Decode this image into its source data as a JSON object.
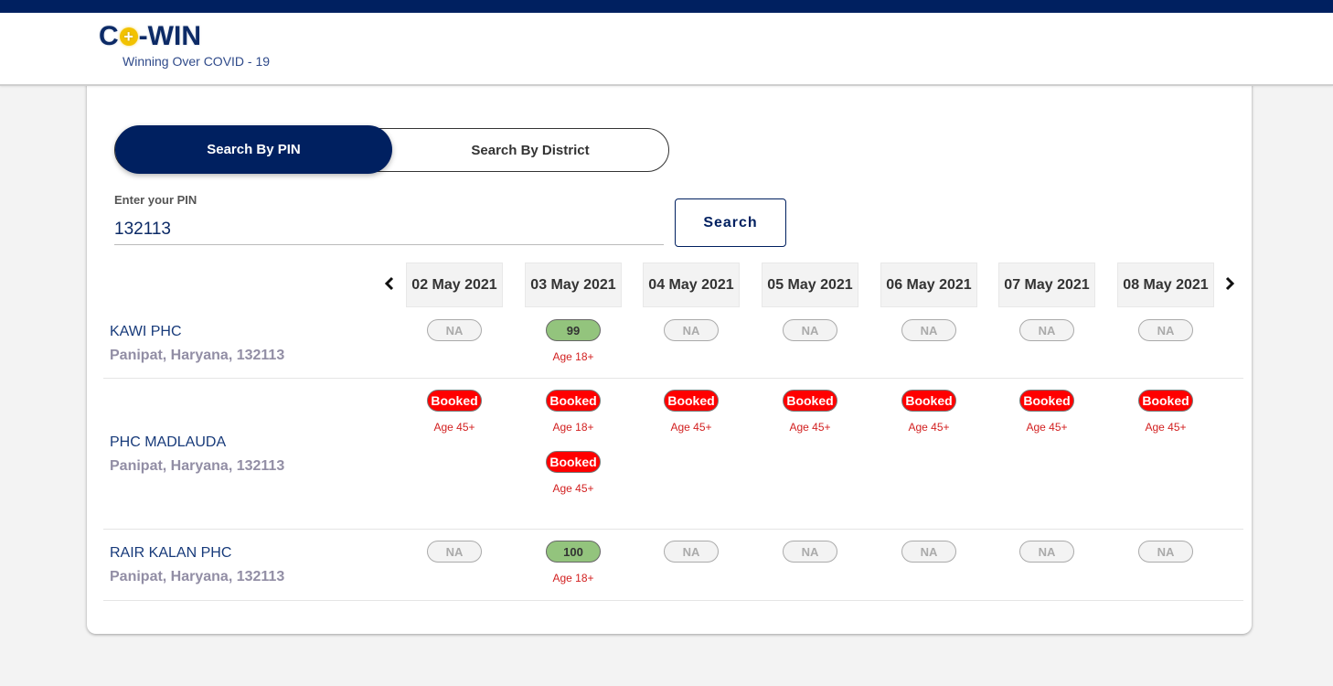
{
  "header": {
    "logo_text_left": "C",
    "logo_text_right": "-WIN",
    "logo_plus_symbol": "+",
    "tagline": "Winning Over COVID - 19"
  },
  "search": {
    "tabs": [
      {
        "label": "Search By PIN",
        "active": true
      },
      {
        "label": "Search By District",
        "active": false
      }
    ],
    "pin_label": "Enter your PIN",
    "pin_value": "132113",
    "search_button": "Search"
  },
  "dates": {
    "prev_icon": "‹",
    "next_icon": "›",
    "list": [
      "02 May 2021",
      "03 May 2021",
      "04 May 2021",
      "05 May 2021",
      "06 May 2021",
      "07 May 2021",
      "08 May 2021"
    ]
  },
  "centers": [
    {
      "name": "KAWI PHC",
      "address": "Panipat, Haryana, 132113",
      "slots": [
        [
          {
            "status": "NA",
            "label": "NA"
          }
        ],
        [
          {
            "status": "available",
            "label": "99",
            "age": "Age 18+"
          }
        ],
        [
          {
            "status": "NA",
            "label": "NA"
          }
        ],
        [
          {
            "status": "NA",
            "label": "NA"
          }
        ],
        [
          {
            "status": "NA",
            "label": "NA"
          }
        ],
        [
          {
            "status": "NA",
            "label": "NA"
          }
        ],
        [
          {
            "status": "NA",
            "label": "NA"
          }
        ]
      ]
    },
    {
      "name": "PHC MADLAUDA",
      "address": "Panipat, Haryana, 132113",
      "slots": [
        [
          {
            "status": "booked",
            "label": "Booked",
            "age": "Age 45+"
          }
        ],
        [
          {
            "status": "booked",
            "label": "Booked",
            "age": "Age 18+"
          },
          {
            "status": "booked",
            "label": "Booked",
            "age": "Age 45+"
          }
        ],
        [
          {
            "status": "booked",
            "label": "Booked",
            "age": "Age 45+"
          }
        ],
        [
          {
            "status": "booked",
            "label": "Booked",
            "age": "Age 45+"
          }
        ],
        [
          {
            "status": "booked",
            "label": "Booked",
            "age": "Age 45+"
          }
        ],
        [
          {
            "status": "booked",
            "label": "Booked",
            "age": "Age 45+"
          }
        ],
        [
          {
            "status": "booked",
            "label": "Booked",
            "age": "Age 45+"
          }
        ]
      ]
    },
    {
      "name": "RAIR KALAN PHC",
      "address": "Panipat, Haryana, 132113",
      "slots": [
        [
          {
            "status": "NA",
            "label": "NA"
          }
        ],
        [
          {
            "status": "available",
            "label": "100",
            "age": "Age 18+"
          }
        ],
        [
          {
            "status": "NA",
            "label": "NA"
          }
        ],
        [
          {
            "status": "NA",
            "label": "NA"
          }
        ],
        [
          {
            "status": "NA",
            "label": "NA"
          }
        ],
        [
          {
            "status": "NA",
            "label": "NA"
          }
        ],
        [
          {
            "status": "NA",
            "label": "NA"
          }
        ]
      ]
    }
  ],
  "colors": {
    "brand_navy": "#002060",
    "available_green": "#93c47d",
    "booked_red": "#ff0000",
    "age_text_red": "#d21f1f"
  }
}
